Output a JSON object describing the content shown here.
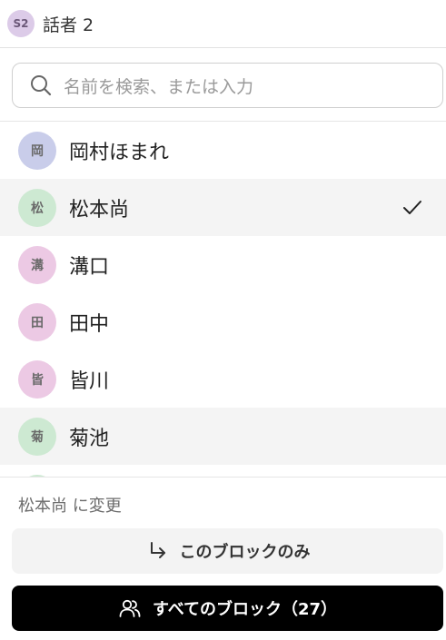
{
  "header": {
    "badge": "S2",
    "speaker_name": "話者 2"
  },
  "search": {
    "placeholder": "名前を検索、または入力"
  },
  "list": {
    "items": [
      {
        "initial": "岡",
        "label": "岡村ほまれ",
        "avatar_color": "#c9cdea",
        "highlighted": false,
        "selected": false
      },
      {
        "initial": "松",
        "label": "松本尚",
        "avatar_color": "#cde9d2",
        "highlighted": true,
        "selected": true
      },
      {
        "initial": "溝",
        "label": "溝口",
        "avatar_color": "#ecc9e4",
        "highlighted": false,
        "selected": false
      },
      {
        "initial": "田",
        "label": "田中",
        "avatar_color": "#ecc9e4",
        "highlighted": false,
        "selected": false
      },
      {
        "initial": "皆",
        "label": "皆川",
        "avatar_color": "#ecc9e4",
        "highlighted": false,
        "selected": false
      },
      {
        "initial": "菊",
        "label": "菊池",
        "avatar_color": "#cde9d2",
        "highlighted": true,
        "selected": false
      },
      {
        "initial": "",
        "label": "",
        "avatar_color": "#cde9d2",
        "highlighted": false,
        "selected": false
      }
    ]
  },
  "footer": {
    "change_label": "松本尚 に変更",
    "block_only_label": "このブロックのみ",
    "all_blocks_label": "すべてのブロック（27）"
  },
  "icons": {
    "search": "search-icon",
    "check": "check-icon",
    "reply_arrow": "return-arrow-icon",
    "users": "users-icon"
  }
}
